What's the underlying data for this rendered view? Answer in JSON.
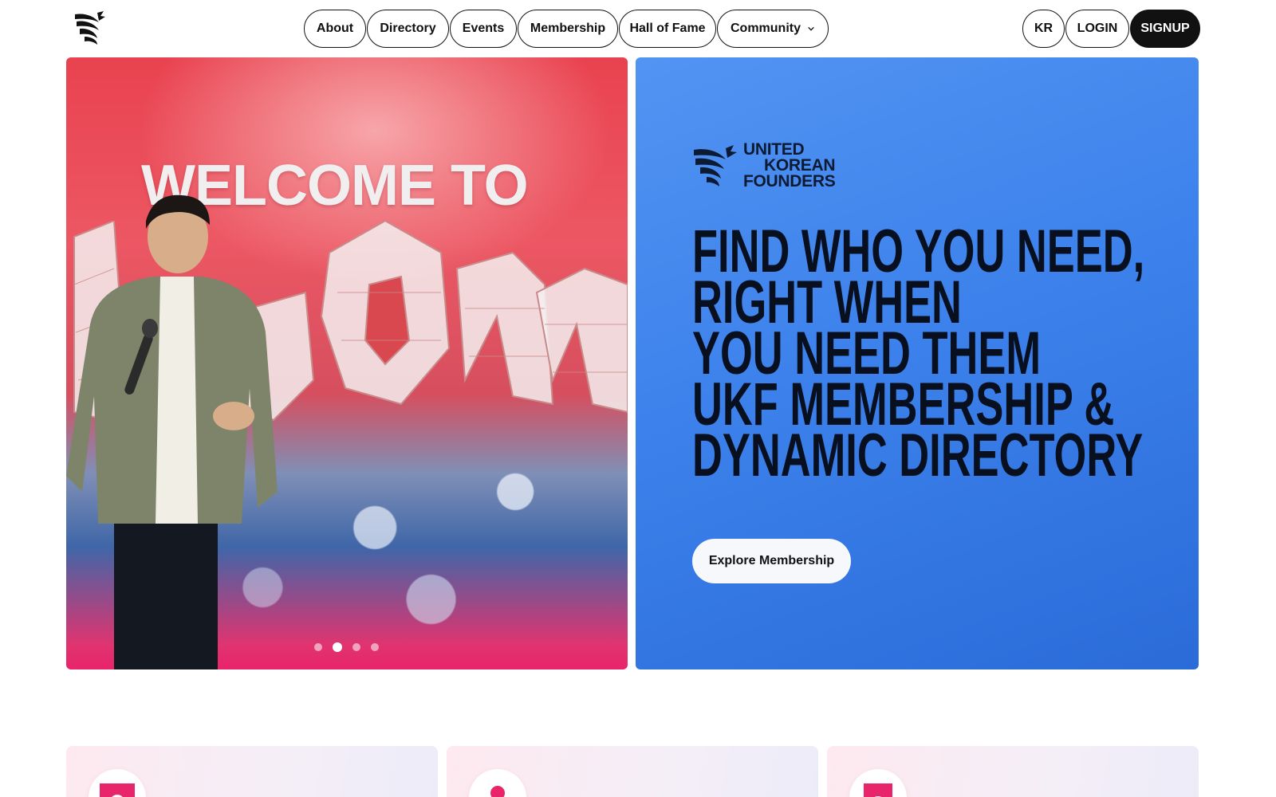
{
  "header": {
    "logo_icon": "phoenix-logo-icon",
    "nav": [
      {
        "label": "About"
      },
      {
        "label": "Directory"
      },
      {
        "label": "Events"
      },
      {
        "label": "Membership"
      },
      {
        "label": "Hall of Fame"
      },
      {
        "label": "Community",
        "icon": "chevron-down-icon"
      }
    ],
    "actions": {
      "language": "KR",
      "login": "LOGIN",
      "signup": "SIGNUP"
    }
  },
  "hero": {
    "slide_image": {
      "banner_text": "WELCOME TO",
      "slide_count": 4,
      "active_slide": 2
    },
    "logo": {
      "line1": "UNITED",
      "line2": "KOREAN",
      "line3": "FOUNDERS"
    },
    "headline_lines": [
      "FIND WHO YOU NEED,",
      "RIGHT WHEN",
      "YOU NEED THEM",
      "UKF MEMBERSHIP &",
      "DYNAMIC DIRECTORY"
    ],
    "cta_label": "Explore Membership"
  },
  "feature_cards": [
    {
      "icon": "document-icon"
    },
    {
      "icon": "person-icon"
    },
    {
      "icon": "document-icon"
    }
  ],
  "colors": {
    "accent_pink": "#e8246a",
    "hero_blue": "#3d82ec",
    "text_dark": "#111111"
  }
}
